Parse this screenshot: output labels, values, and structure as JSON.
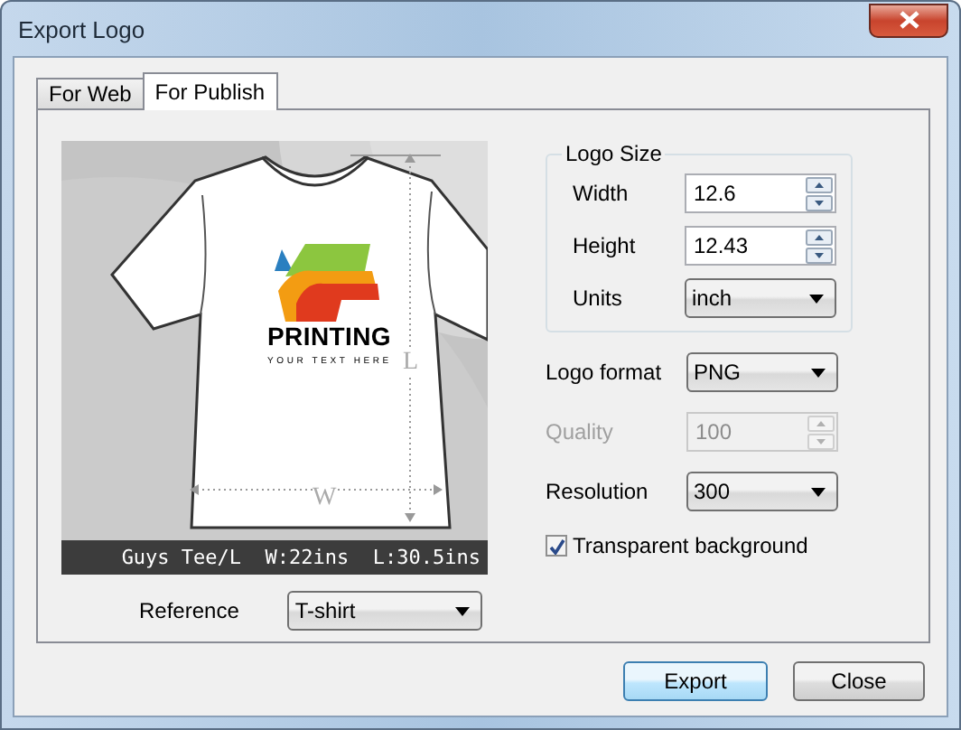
{
  "window": {
    "title": "Export Logo"
  },
  "tabs": [
    {
      "label": "For Web",
      "selected": false
    },
    {
      "label": "For Publish",
      "selected": true
    }
  ],
  "preview": {
    "logo_title": "PRINTING",
    "logo_tagline": "YOUR TEXT HERE",
    "length_label": "L",
    "width_label": "W",
    "caption": "Guys Tee/L  W:22ins  L:30.5ins"
  },
  "reference": {
    "label": "Reference",
    "value": "T-shirt"
  },
  "logo_size": {
    "title": "Logo Size",
    "rows": [
      {
        "kind": "spin",
        "label": "Width",
        "value": "12.6",
        "disabled": false
      },
      {
        "kind": "spin",
        "label": "Height",
        "value": "12.43",
        "disabled": false
      },
      {
        "kind": "select",
        "label": "Units",
        "value": "inch",
        "disabled": false
      }
    ]
  },
  "options": [
    {
      "kind": "select",
      "label": "Logo format",
      "value": "PNG",
      "disabled": false
    },
    {
      "kind": "spin",
      "label": "Quality",
      "value": "100",
      "disabled": true
    },
    {
      "kind": "select",
      "label": "Resolution",
      "value": "300",
      "disabled": false
    }
  ],
  "transparent_background": {
    "label": "Transparent background",
    "checked": true
  },
  "buttons": [
    {
      "label": "Export",
      "default": true
    },
    {
      "label": "Close",
      "default": false
    }
  ]
}
